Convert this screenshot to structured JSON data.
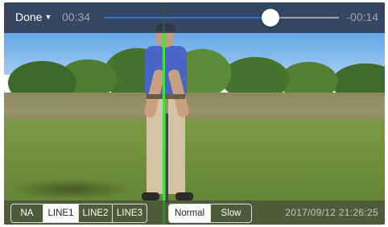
{
  "topbar": {
    "done_label": "Done",
    "elapsed": "00:34",
    "remaining": "-00:14",
    "progress": 0.71,
    "colors": {
      "bar": "#323a4e",
      "fill": "#2a74e0"
    }
  },
  "line_modes": {
    "items": [
      {
        "label": "NA",
        "active": false
      },
      {
        "label": "LINE1",
        "active": true
      },
      {
        "label": "LINE2",
        "active": false
      },
      {
        "label": "LINE3",
        "active": false
      }
    ]
  },
  "speed_modes": {
    "items": [
      {
        "label": "Normal",
        "active": true
      },
      {
        "label": "Slow",
        "active": false
      }
    ]
  },
  "timestamp": "2017/09/12 21:26:25",
  "overlay_line_color": "#3fe23f"
}
